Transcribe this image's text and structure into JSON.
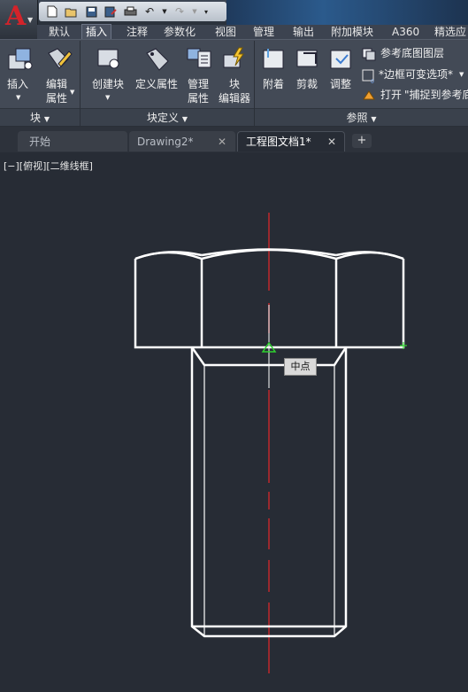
{
  "app": {
    "logo_letter": "A"
  },
  "quick_access": {
    "icons": [
      "new-icon",
      "open-icon",
      "save-icon",
      "save-as-icon",
      "print-icon",
      "undo-icon",
      "redo-icon",
      "customize-icon"
    ]
  },
  "menu_tabs": [
    {
      "label": "默认"
    },
    {
      "label": "插入",
      "active": true
    },
    {
      "label": "注释"
    },
    {
      "label": "参数化"
    },
    {
      "label": "视图"
    },
    {
      "label": "管理"
    },
    {
      "label": "输出"
    },
    {
      "label": "附加模块"
    },
    {
      "label": "A360"
    },
    {
      "label": "精选应"
    }
  ],
  "ribbon": {
    "block_panel": {
      "title": "块",
      "insert": "插入",
      "edit_attr_line1": "编辑",
      "edit_attr_line2": "属性"
    },
    "block_def_panel": {
      "title": "块定义",
      "create_block": "创建块",
      "define_attr": "定义属性",
      "manage_attr_line1": "管理",
      "manage_attr_line2": "属性",
      "block_editor_line1": "块",
      "block_editor_line2": "编辑器"
    },
    "reference_panel": {
      "title": "参照",
      "attach": "附着",
      "clip": "剪裁",
      "adjust": "调整",
      "underlay_layers": "参考底图图层",
      "frame_variable": "*边框可变选项*",
      "snap_open": "打开",
      "snap_to": "\"捕捉到参考底"
    }
  },
  "doc_tabs": [
    {
      "label": "开始"
    },
    {
      "label": "Drawing2*"
    },
    {
      "label": "工程图文档1*",
      "active": true
    }
  ],
  "canvas": {
    "view_label": "[−][俯视][二维线框]",
    "tooltip": "中点"
  },
  "colors": {
    "background": "#272c35",
    "centerline": "#c0282d",
    "snap": "#2fd22f",
    "geometry": "#ffffff"
  }
}
